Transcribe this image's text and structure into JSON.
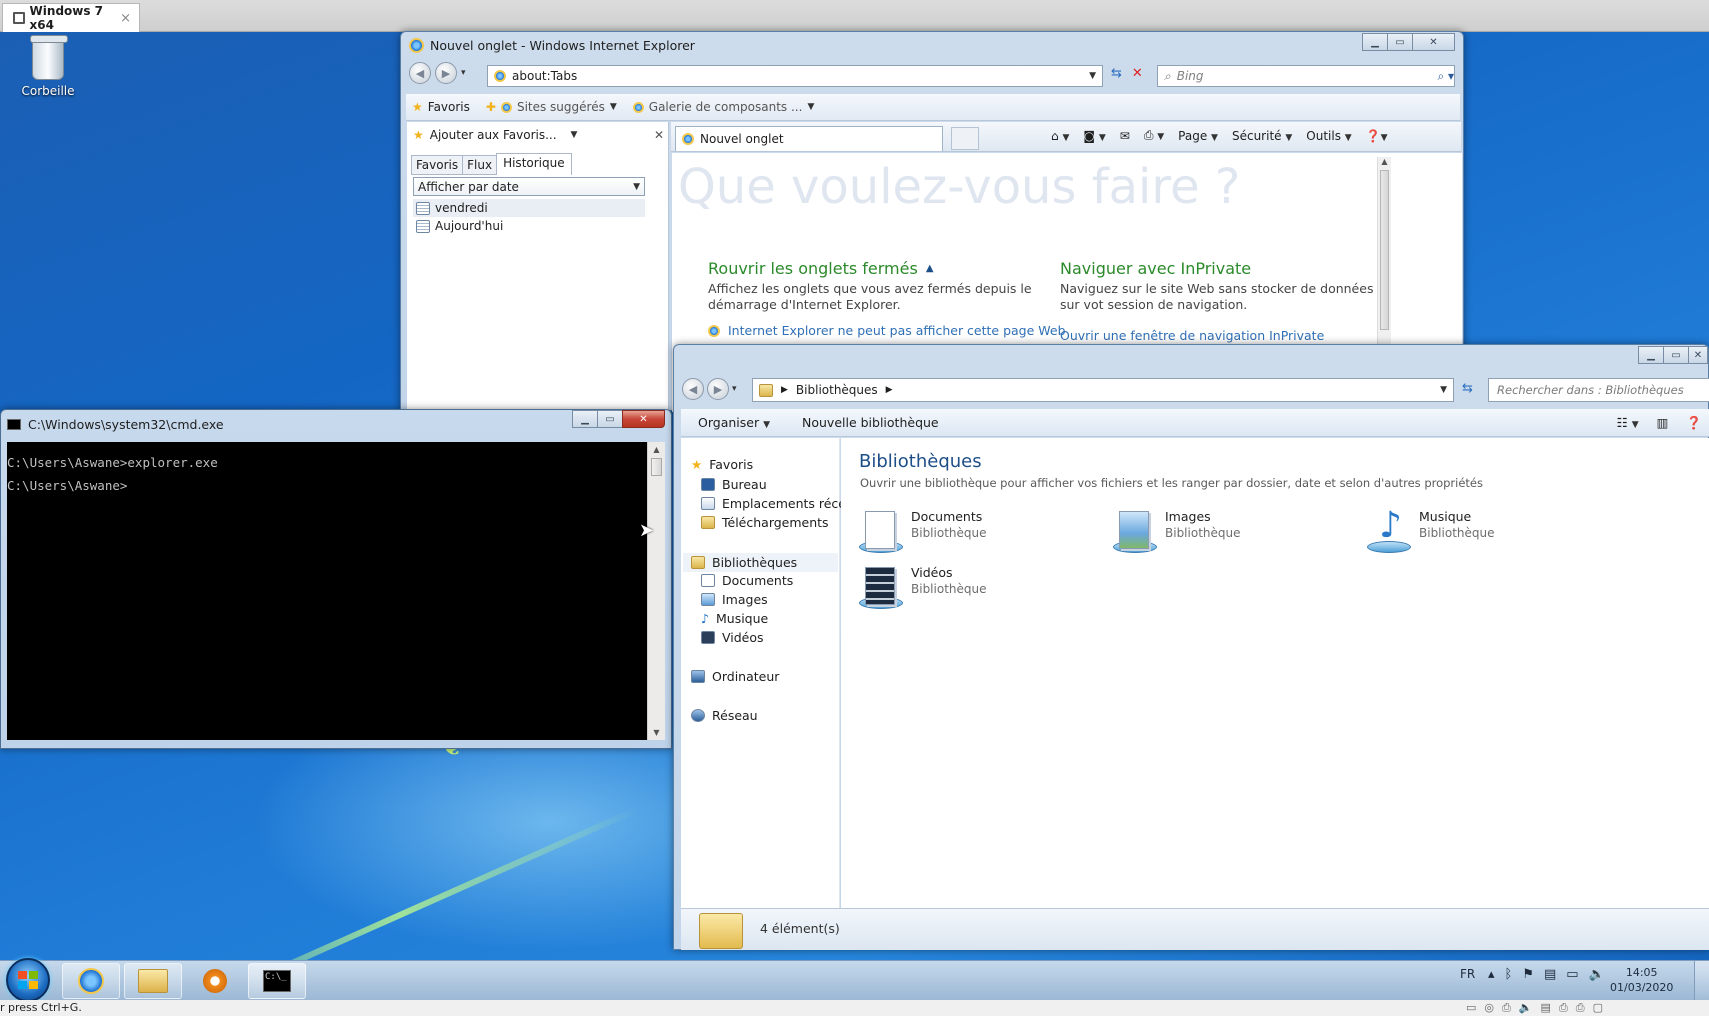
{
  "vm": {
    "tab_title": "Windows 7 x64",
    "tab_close": "×"
  },
  "desktop": {
    "recycle_label": "Corbeille"
  },
  "ie": {
    "title": "Nouvel onglet - Windows Internet Explorer",
    "address": "about:Tabs",
    "search_placeholder": "Bing",
    "fav_label": "Favoris",
    "suggested_sites": "Sites suggérés",
    "gallery": "Galerie de composants ...",
    "add_to_favorites": "Ajouter aux Favoris...",
    "pane_tabs": [
      "Favoris",
      "Flux",
      "Historique"
    ],
    "view_select": "Afficher par date",
    "history_items": [
      "vendredi",
      "Aujourd'hui"
    ],
    "tab_label": "Nouvel onglet",
    "toolbar": {
      "page": "Page",
      "security": "Sécurité",
      "tools": "Outils"
    },
    "heading": "Que voulez-vous faire ?",
    "reopen_title": "Rouvrir les onglets fermés",
    "reopen_text": "Affichez les onglets que vous avez fermés depuis le démarrage d'Internet Explorer.",
    "reopen_link": "Internet Explorer ne peut pas afficher cette page Web",
    "inprivate_title": "Naviguer avec InPrivate",
    "inprivate_text": "Naviguez sur le site Web sans stocker de données sur vot session de navigation.",
    "inprivate_link": "Ouvrir une fenêtre de navigation InPrivate"
  },
  "cmd": {
    "title": "C:\\Windows\\system32\\cmd.exe",
    "lines": [
      "C:\\Users\\Aswane>explorer.exe",
      "C:\\Users\\Aswane>"
    ]
  },
  "explorer": {
    "breadcrumb": "Bibliothèques",
    "search_placeholder": "Rechercher dans : Bibliothèques",
    "organize": "Organiser",
    "new_library": "Nouvelle bibliothèque",
    "nav": {
      "favorites": "Favoris",
      "desktop": "Bureau",
      "recent": "Emplacements récer",
      "downloads": "Téléchargements",
      "libraries": "Bibliothèques",
      "documents": "Documents",
      "images": "Images",
      "music": "Musique",
      "videos": "Vidéos",
      "computer": "Ordinateur",
      "network": "Réseau"
    },
    "heading": "Bibliothèques",
    "subheading": "Ouvrir une bibliothèque pour afficher vos fichiers et les ranger par dossier, date et selon d'autres propriétés",
    "libraries": [
      {
        "name": "Documents",
        "type": "Bibliothèque"
      },
      {
        "name": "Images",
        "type": "Bibliothèque"
      },
      {
        "name": "Musique",
        "type": "Bibliothèque"
      },
      {
        "name": "Vidéos",
        "type": "Bibliothèque"
      }
    ],
    "status": "4 élément(s)"
  },
  "taskbar": {
    "lang": "FR",
    "time": "14:05",
    "date": "01/03/2020"
  },
  "statusbar": {
    "text": "r press Ctrl+G."
  },
  "colors": {
    "desktop": "#1466c4",
    "ie_green": "#2b8a2b",
    "link_blue": "#2f6fb5"
  }
}
